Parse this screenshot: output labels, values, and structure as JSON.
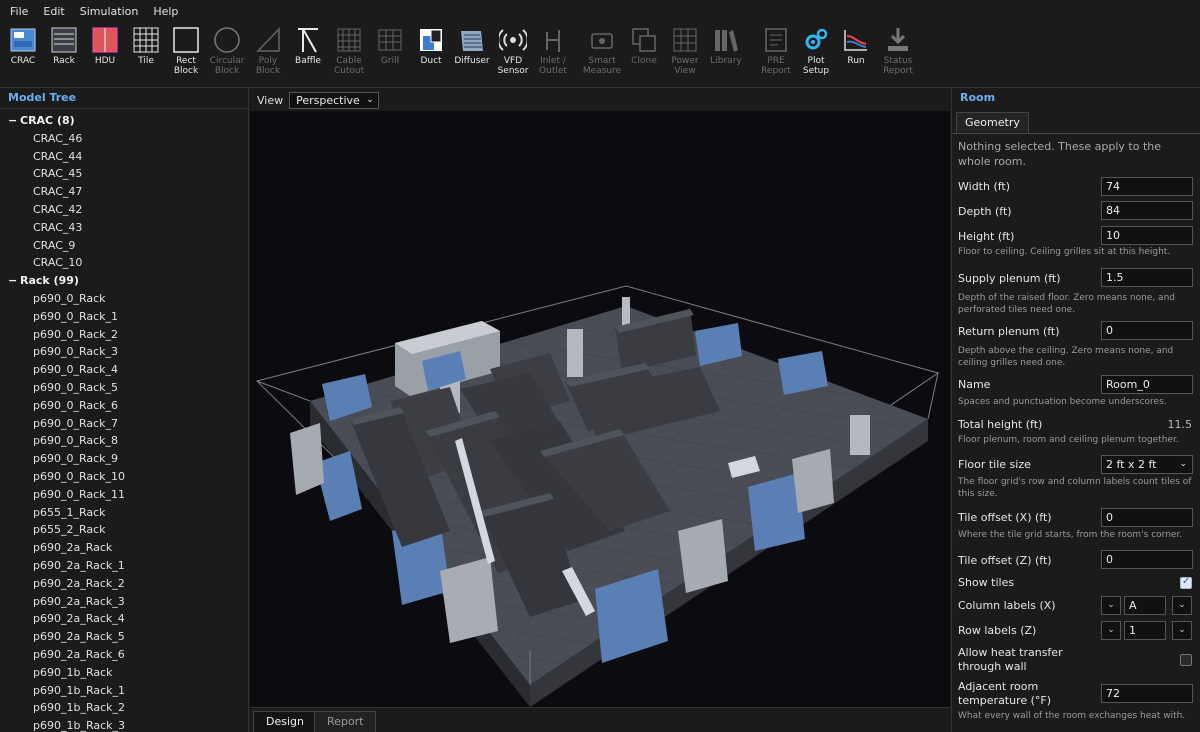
{
  "menu": [
    "File",
    "Edit",
    "Simulation",
    "Help"
  ],
  "toolbar": [
    {
      "label": "CRAC",
      "icon": "crac-icon",
      "enabled": true
    },
    {
      "label": "Rack",
      "icon": "rack-icon",
      "enabled": true
    },
    {
      "label": "HDU",
      "icon": "hdu-icon",
      "enabled": true
    },
    {
      "label": "Tile",
      "icon": "tile-icon",
      "enabled": true
    },
    {
      "label": "Rect\nBlock",
      "icon": "rect-block-icon",
      "enabled": true
    },
    {
      "label": "Circular\nBlock",
      "icon": "circular-block-icon",
      "enabled": false
    },
    {
      "label": "Poly\nBlock",
      "icon": "poly-block-icon",
      "enabled": false
    },
    {
      "label": "Baffle",
      "icon": "baffle-icon",
      "enabled": true
    },
    {
      "label": "Cable\nCutout",
      "icon": "cable-cutout-icon",
      "enabled": false
    },
    {
      "label": "Grill",
      "icon": "grill-icon",
      "enabled": false
    },
    {
      "label": "Duct",
      "icon": "duct-icon",
      "enabled": true
    },
    {
      "label": "Diffuser",
      "icon": "diffuser-icon",
      "enabled": true
    },
    {
      "label": "VFD\nSensor",
      "icon": "vfd-sensor-icon",
      "enabled": true
    },
    {
      "label": "Inlet /\nOutlet",
      "icon": "inlet-outlet-icon",
      "enabled": false
    },
    {
      "label": "Smart\nMeasure",
      "icon": "smart-measure-icon",
      "enabled": false
    },
    {
      "label": "Clone",
      "icon": "clone-icon",
      "enabled": false
    },
    {
      "label": "Power\nView",
      "icon": "power-view-icon",
      "enabled": false
    },
    {
      "label": "Library",
      "icon": "library-icon",
      "enabled": false
    },
    {
      "label": "PRE\nReport",
      "icon": "pre-report-icon",
      "enabled": false
    },
    {
      "label": "Plot\nSetup",
      "icon": "plot-setup-icon",
      "enabled": true
    },
    {
      "label": "Run",
      "icon": "run-icon",
      "enabled": true
    },
    {
      "label": "Status\nReport",
      "icon": "status-report-icon",
      "enabled": false
    }
  ],
  "model_tree": {
    "title": "Model Tree",
    "groups": [
      {
        "label": "CRAC (8)",
        "toggle": "−",
        "items": [
          "CRAC_46",
          "CRAC_44",
          "CRAC_45",
          "CRAC_47",
          "CRAC_42",
          "CRAC_43",
          "CRAC_9",
          "CRAC_10"
        ]
      },
      {
        "label": "Rack (99)",
        "toggle": "−",
        "items": [
          "p690_0_Rack",
          "p690_0_Rack_1",
          "p690_0_Rack_2",
          "p690_0_Rack_3",
          "p690_0_Rack_4",
          "p690_0_Rack_5",
          "p690_0_Rack_6",
          "p690_0_Rack_7",
          "p690_0_Rack_8",
          "p690_0_Rack_9",
          "p690_0_Rack_10",
          "p690_0_Rack_11",
          "p655_1_Rack",
          "p655_2_Rack",
          "p690_2a_Rack",
          "p690_2a_Rack_1",
          "p690_2a_Rack_2",
          "p690_2a_Rack_3",
          "p690_2a_Rack_4",
          "p690_2a_Rack_5",
          "p690_2a_Rack_6",
          "p690_1b_Rack",
          "p690_1b_Rack_1",
          "p690_1b_Rack_2",
          "p690_1b_Rack_3"
        ]
      }
    ]
  },
  "view": {
    "label": "View",
    "mode": "Perspective"
  },
  "bottom_tabs": [
    "Design",
    "Report"
  ],
  "room_panel": {
    "title": "Room",
    "tab": "Geometry",
    "note": "Nothing selected. These apply to the whole room.",
    "width_label": "Width (ft)",
    "width": "74",
    "depth_label": "Depth (ft)",
    "depth": "84",
    "height_label": "Height (ft)",
    "height": "10",
    "height_hint": "Floor to ceiling. Ceiling grilles sit at this height.",
    "supply_label": "Supply plenum (ft)",
    "supply": "1.5",
    "supply_hint": "Depth of the raised floor. Zero means none, and perforated tiles need one.",
    "return_label": "Return plenum (ft)",
    "return": "0",
    "return_hint": "Depth above the ceiling. Zero means none, and ceiling grilles need one.",
    "name_label": "Name",
    "name": "Room_0",
    "name_hint": "Spaces and punctuation become underscores.",
    "total_label": "Total height (ft)",
    "total": "11.5",
    "total_hint": "Floor plenum, room and ceiling plenum together.",
    "tile_size_label": "Floor tile size",
    "tile_size": "2 ft x 2 ft",
    "tile_size_hint": "The floor grid's row and column labels count tiles of this size.",
    "offx_label": "Tile offset (X) (ft)",
    "offx": "0",
    "offx_hint": "Where the tile grid starts, from the room's corner.",
    "offz_label": "Tile offset (Z) (ft)",
    "offz": "0",
    "show_tiles_label": "Show tiles",
    "show_tiles": true,
    "col_label": "Column labels (X)",
    "col": "A",
    "row_label": "Row labels (Z)",
    "row": "1",
    "heat_label": "Allow heat transfer\nthrough wall",
    "heat": false,
    "adj_label": "Adjacent room\ntemperature (°F)",
    "adj": "72",
    "adj_hint": "What every wall of the room exchanges heat with."
  }
}
